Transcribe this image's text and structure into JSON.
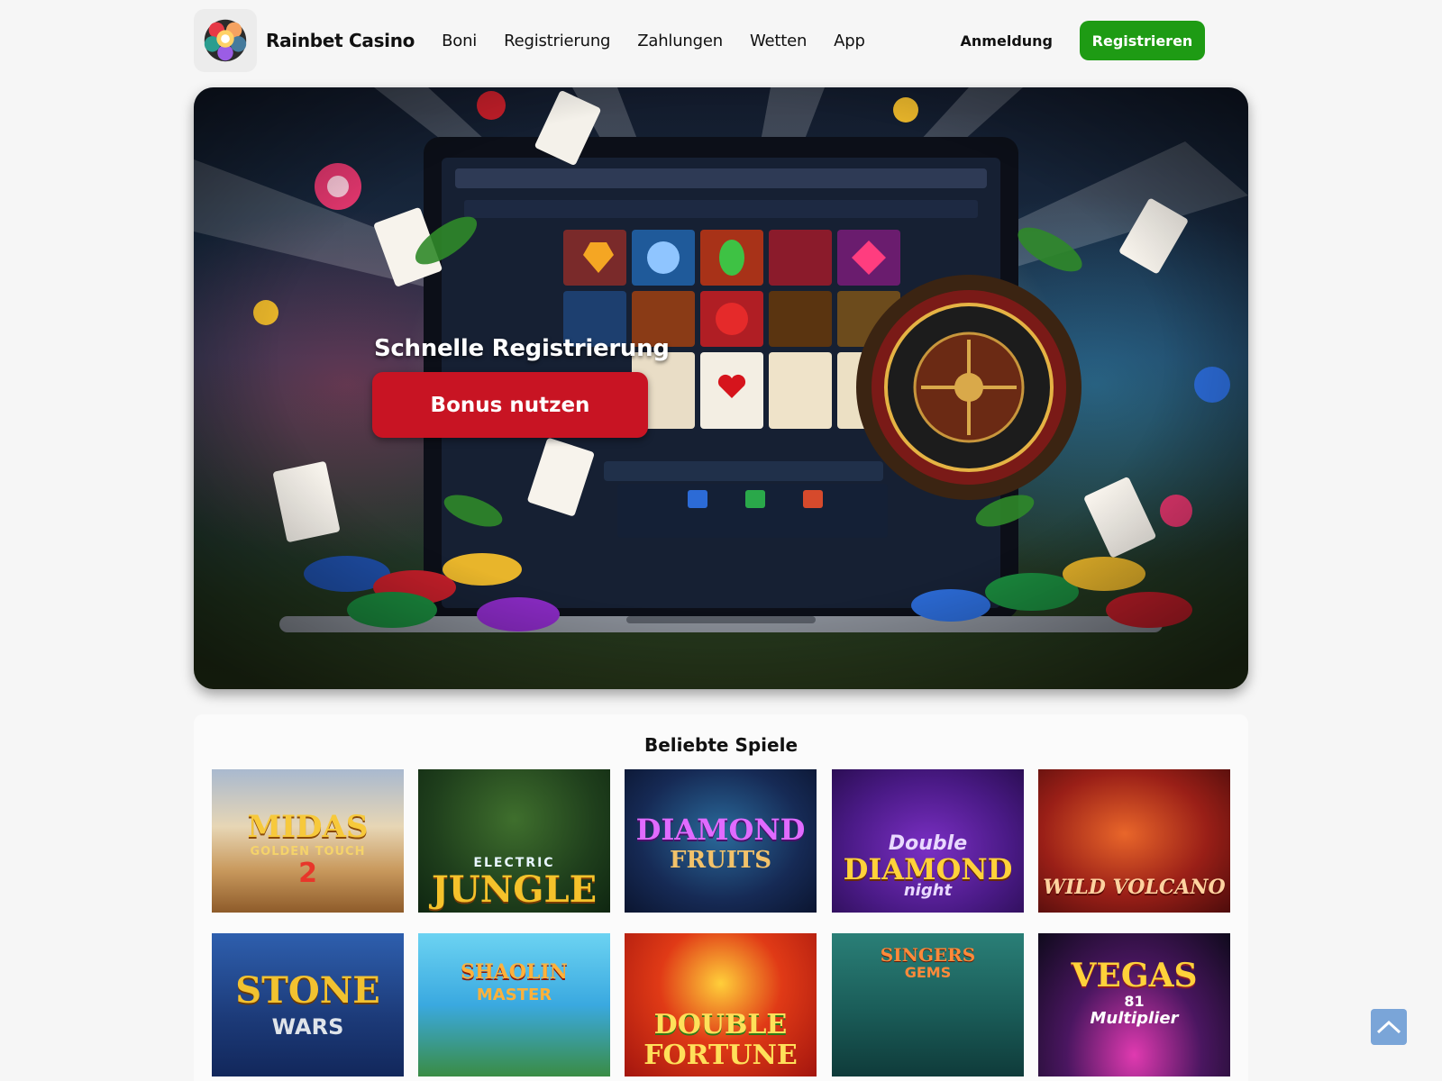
{
  "header": {
    "brand": "Rainbet Casino",
    "nav": [
      "Boni",
      "Registrierung",
      "Zahlungen",
      "Wetten",
      "App"
    ],
    "login_label": "Anmeldung",
    "register_label": "Registrieren",
    "accent_color": "#1e9b14"
  },
  "hero": {
    "title": "Schnelle Registrierung",
    "cta_label": "Bonus nutzen",
    "cta_color": "#c81423"
  },
  "games": {
    "title": "Beliebte Spiele",
    "items": [
      {
        "name": "MIDAS",
        "sub": "GOLDEN TOUCH",
        "extra": "2"
      },
      {
        "name": "JUNGLE",
        "sub": "ELECTRIC"
      },
      {
        "name": "DIAMOND",
        "sub": "FRUITS"
      },
      {
        "name": "DIAMOND",
        "sub": "Double",
        "extra": "night"
      },
      {
        "name": "WILD VOLCANO"
      },
      {
        "name": "STONE",
        "sub": "WARS"
      },
      {
        "name": "SHAOLIN",
        "sub": "MASTER"
      },
      {
        "name": "DOUBLE",
        "sub": "FORTUNE"
      },
      {
        "name": "SINGERS",
        "sub": "GEMS"
      },
      {
        "name": "VEGAS",
        "sub": "Multiplier",
        "extra": "81"
      }
    ]
  },
  "icons": {
    "logo": "rainbow-chips-logo-icon",
    "scroll_top": "chevron-up-icon"
  }
}
